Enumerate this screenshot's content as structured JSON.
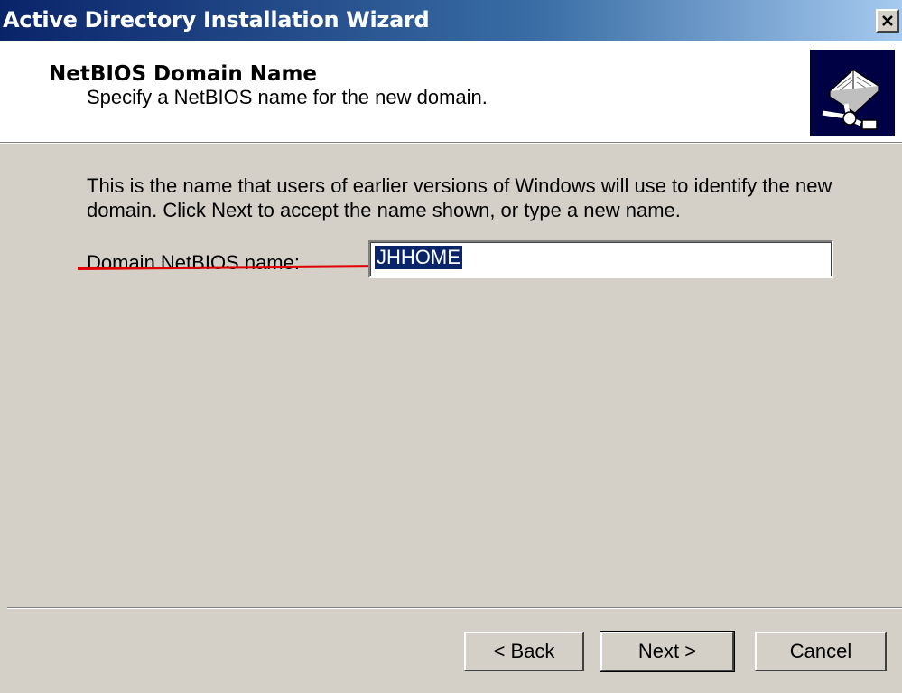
{
  "window": {
    "title": "Active Directory Installation Wizard"
  },
  "header": {
    "title": "NetBIOS Domain Name",
    "subtitle": "Specify a NetBIOS name for the new domain.",
    "icon": "book-network-icon"
  },
  "body": {
    "description": "This is the name that users of earlier versions of Windows will use to identify the new domain. Click Next to accept the name shown, or type a new name.",
    "field_label": "Domain NetBIOS name:",
    "field_value": "JHHOME"
  },
  "buttons": {
    "back": "< Back",
    "next": "Next >",
    "cancel": "Cancel"
  },
  "colors": {
    "title_bar": "#0a246a",
    "selection": "#0a246a",
    "annotation": "#e00000",
    "dialog_bg": "#d4d0c8"
  }
}
